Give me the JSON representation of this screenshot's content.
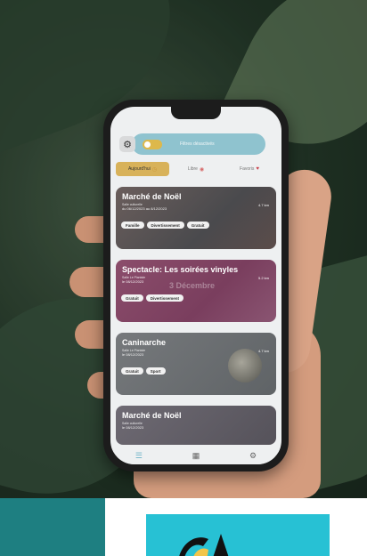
{
  "app": {
    "search_label": "Filtres désactivés",
    "tabs": [
      {
        "label": "Aujourd'hui",
        "icon": "clock-icon"
      },
      {
        "label": "Libre",
        "icon": "circle-icon"
      },
      {
        "label": "Favoris",
        "icon": "heart-icon"
      }
    ],
    "cards": [
      {
        "title": "Marché de Noël",
        "subtitle": "Salle culturelle",
        "date": "du 06/12/2023 au 8/12/2023",
        "distance": "4.7 km",
        "tags": [
          "Famille",
          "Divertissement",
          "Gratuit"
        ]
      },
      {
        "title": "Spectacle: Les soirées vinyles",
        "subtitle": "Salle Le Pianiste",
        "date": "le 08/12/2023",
        "distance": "5.2 km",
        "overlay": "3 Décembre",
        "tags": [
          "Gratuit",
          "Divertissement"
        ]
      },
      {
        "title": "Caninarche",
        "subtitle": "Salle Le Pianiste",
        "date": "le 08/12/2023",
        "distance": "4.7 km",
        "tags": [
          "Gratuit",
          "Sport"
        ]
      },
      {
        "title": "Marché de Noël",
        "subtitle": "Salle culturelle",
        "date": "le 08/12/2023",
        "distance": "",
        "tags": []
      }
    ],
    "nav": [
      "home-icon",
      "map-icon",
      "settings-icon"
    ]
  },
  "colors": {
    "teal": "#1e7f81",
    "cyan": "#27c1d4",
    "accent": "#d8b25a",
    "topbar": "#8fc3cf"
  }
}
